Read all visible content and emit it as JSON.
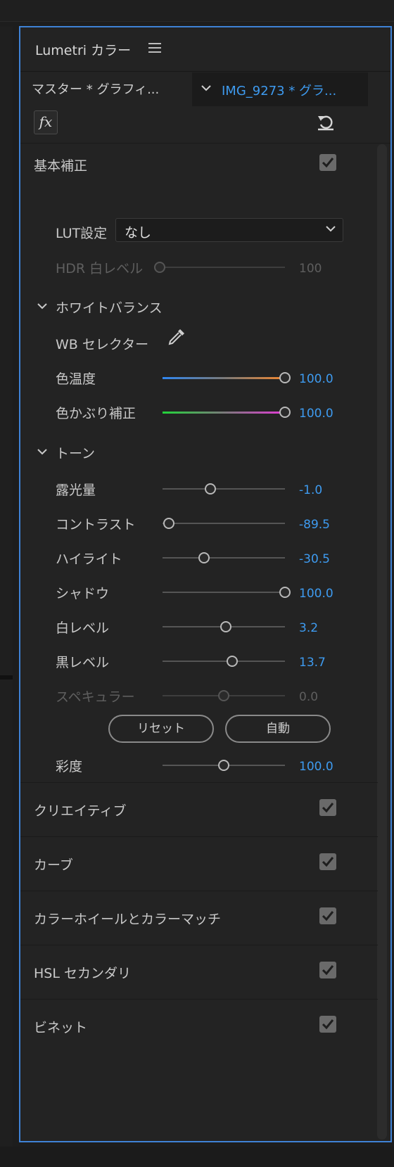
{
  "panel": {
    "title": "Lumetri カラー",
    "tabs": {
      "master": "マスター * グラフィ...",
      "clip": "IMG_9273 * グラ..."
    },
    "fx_label": "fx"
  },
  "basic": {
    "title": "基本補正",
    "checked": true,
    "lut": {
      "label": "LUT設定",
      "value": "なし"
    },
    "hdr": {
      "label": "HDR 白レベル",
      "value": "100"
    },
    "wb": {
      "title": "ホワイトバランス",
      "selector_label": "WB セレクター",
      "temp": {
        "label": "色温度",
        "value": "100.0",
        "position": 1.0
      },
      "tint": {
        "label": "色かぶり補正",
        "value": "100.0",
        "position": 1.0
      }
    },
    "tone": {
      "title": "トーン",
      "sliders": [
        {
          "label": "露光量",
          "value": "-1.0",
          "position": 0.39
        },
        {
          "label": "コントラスト",
          "value": "-89.5",
          "position": 0.05
        },
        {
          "label": "ハイライト",
          "value": "-30.5",
          "position": 0.34
        },
        {
          "label": "シャドウ",
          "value": "100.0",
          "position": 1.0
        },
        {
          "label": "白レベル",
          "value": "3.2",
          "position": 0.52
        },
        {
          "label": "黒レベル",
          "value": "13.7",
          "position": 0.57
        },
        {
          "label": "スペキュラー",
          "value": "0.0",
          "position": 0.5
        }
      ],
      "reset_button": "リセット",
      "auto_button": "自動"
    },
    "saturation": {
      "label": "彩度",
      "value": "100.0",
      "position": 0.5
    }
  },
  "sections": [
    {
      "title": "クリエイティブ",
      "checked": true
    },
    {
      "title": "カーブ",
      "checked": true
    },
    {
      "title": "カラーホイールとカラーマッチ",
      "checked": true
    },
    {
      "title": "HSL セカンダリ",
      "checked": true
    },
    {
      "title": "ビネット",
      "checked": true
    }
  ],
  "colors": {
    "accent": "#3e9bf0",
    "panel_border": "#3f82d6",
    "panel_bg": "#232323",
    "temp_gradient": [
      "#2f86f0",
      "#7a7a7a",
      "#f0862f"
    ],
    "tint_gradient": [
      "#22d43a",
      "#7a7a7a",
      "#e23ad6"
    ]
  }
}
